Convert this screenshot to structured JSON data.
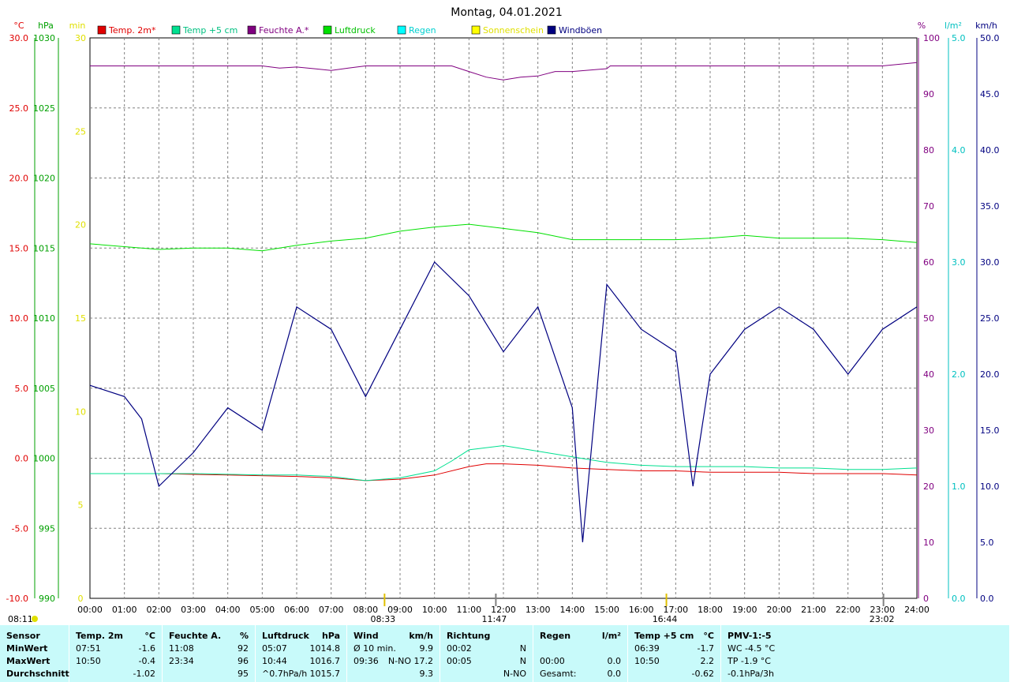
{
  "title": "Montag, 04.01.2021",
  "legend": [
    {
      "label": "Temp. 2m*",
      "color": "#e00000",
      "textColor": "#e00000"
    },
    {
      "label": "Temp +5 cm",
      "color": "#00e090",
      "textColor": "#00c080"
    },
    {
      "label": "Feuchte A.*",
      "color": "#800080",
      "textColor": "#800080"
    },
    {
      "label": "Luftdruck",
      "color": "#00e000",
      "textColor": "#00c000"
    },
    {
      "label": "Regen",
      "color": "#00ffff",
      "textColor": "#00d0d0"
    },
    {
      "label": "Sonnenschein",
      "color": "#ffff00",
      "textColor": "#e0e000"
    },
    {
      "label": "Windböen",
      "color": "#000080",
      "textColor": "#000080"
    }
  ],
  "axes": {
    "temp": {
      "unit": "°C",
      "color": "#e00000",
      "ticks": [
        "30.0",
        "25.0",
        "20.0",
        "15.0",
        "10.0",
        "5.0",
        "0.0",
        "-5.0",
        "-10.0"
      ]
    },
    "pressure": {
      "unit": "hPa",
      "color": "#00a000",
      "ticks": [
        "1030",
        "1025",
        "1020",
        "1015",
        "1010",
        "1005",
        "1000",
        "995",
        "990"
      ]
    },
    "sunshine": {
      "unit": "min",
      "color": "#e0e000",
      "ticks": [
        "30",
        "25",
        "20",
        "15",
        "10",
        "5",
        "0"
      ]
    },
    "humidity": {
      "unit": "%",
      "color": "#800080",
      "ticks": [
        "100",
        "90",
        "80",
        "70",
        "60",
        "50",
        "40",
        "30",
        "20",
        "10",
        "0"
      ]
    },
    "rain": {
      "unit": "l/m²",
      "color": "#00c0c0",
      "ticks": [
        "5.0",
        "4.0",
        "3.0",
        "2.0",
        "1.0",
        "0.0"
      ]
    },
    "wind": {
      "unit": "km/h",
      "color": "#000080",
      "ticks": [
        "50.0",
        "45.0",
        "40.0",
        "35.0",
        "30.0",
        "25.0",
        "20.0",
        "15.0",
        "10.0",
        "5.0",
        "0.0"
      ]
    },
    "x": {
      "ticks": [
        "00:00",
        "01:00",
        "02:00",
        "03:00",
        "04:00",
        "05:00",
        "06:00",
        "07:00",
        "08:00",
        "09:00",
        "10:00",
        "11:00",
        "12:00",
        "13:00",
        "14:00",
        "15:00",
        "16:00",
        "17:00",
        "18:00",
        "19:00",
        "20:00",
        "21:00",
        "22:00",
        "23:00",
        "24:00"
      ]
    }
  },
  "markers": {
    "sunrise_label": "08:11",
    "sunrise_hours": 8.55,
    "marks": [
      {
        "label": "08:33",
        "hour": 8.55,
        "color": "#e0c000"
      },
      {
        "label": "11:47",
        "hour": 11.78,
        "color": "#808080"
      },
      {
        "label": "16:44",
        "hour": 16.73,
        "color": "#e0c000"
      },
      {
        "label": "23:02",
        "hour": 23.03,
        "color": "#808080"
      }
    ]
  },
  "chart_data": {
    "type": "line",
    "x_range_hours": [
      0,
      24
    ],
    "ylim": {
      "temp": [
        -10,
        30
      ],
      "pressure": [
        990,
        1030
      ],
      "humidity": [
        0,
        100
      ],
      "wind": [
        0,
        50
      ],
      "rain": [
        0,
        5
      ],
      "sunshine": [
        0,
        30
      ]
    },
    "grid": true,
    "legend_position": "top",
    "series": [
      {
        "name": "Temp. 2m*",
        "axis": "temp",
        "color": "#e00000",
        "points": [
          [
            0,
            -1.1
          ],
          [
            2,
            -1.1
          ],
          [
            4,
            -1.2
          ],
          [
            6,
            -1.3
          ],
          [
            7,
            -1.4
          ],
          [
            8,
            -1.6
          ],
          [
            9,
            -1.5
          ],
          [
            10,
            -1.2
          ],
          [
            11,
            -0.6
          ],
          [
            11.5,
            -0.4
          ],
          [
            12,
            -0.4
          ],
          [
            13,
            -0.5
          ],
          [
            14,
            -0.7
          ],
          [
            15,
            -0.8
          ],
          [
            16,
            -0.9
          ],
          [
            17,
            -0.9
          ],
          [
            18,
            -1.0
          ],
          [
            19,
            -1.0
          ],
          [
            20,
            -1.0
          ],
          [
            21,
            -1.1
          ],
          [
            22,
            -1.1
          ],
          [
            23,
            -1.1
          ],
          [
            24,
            -1.2
          ]
        ]
      },
      {
        "name": "Temp +5 cm",
        "axis": "temp",
        "color": "#00e090",
        "points": [
          [
            0,
            -1.1
          ],
          [
            3,
            -1.1
          ],
          [
            5,
            -1.2
          ],
          [
            6,
            -1.2
          ],
          [
            7,
            -1.3
          ],
          [
            8,
            -1.6
          ],
          [
            9,
            -1.4
          ],
          [
            10,
            -0.9
          ],
          [
            10.5,
            -0.2
          ],
          [
            11,
            0.6
          ],
          [
            12,
            0.9
          ],
          [
            13,
            0.5
          ],
          [
            14,
            0.1
          ],
          [
            15,
            -0.3
          ],
          [
            16,
            -0.5
          ],
          [
            17,
            -0.6
          ],
          [
            18,
            -0.6
          ],
          [
            19,
            -0.6
          ],
          [
            20,
            -0.7
          ],
          [
            21,
            -0.7
          ],
          [
            22,
            -0.8
          ],
          [
            23,
            -0.8
          ],
          [
            24,
            -0.7
          ]
        ]
      },
      {
        "name": "Feuchte A.*",
        "axis": "humidity",
        "color": "#800080",
        "points": [
          [
            0,
            95
          ],
          [
            5,
            95
          ],
          [
            5.5,
            94.6
          ],
          [
            6,
            94.8
          ],
          [
            6.5,
            94.5
          ],
          [
            7,
            94.2
          ],
          [
            7.5,
            94.6
          ],
          [
            8,
            95
          ],
          [
            10,
            95
          ],
          [
            10.5,
            95
          ],
          [
            11,
            94
          ],
          [
            11.5,
            93
          ],
          [
            12,
            92.5
          ],
          [
            12.5,
            93
          ],
          [
            13,
            93.2
          ],
          [
            13.5,
            94
          ],
          [
            14,
            94
          ],
          [
            15,
            94.5
          ],
          [
            15.1,
            95
          ],
          [
            23,
            95
          ],
          [
            24,
            95.6
          ]
        ]
      },
      {
        "name": "Luftdruck",
        "axis": "pressure",
        "color": "#00e000",
        "points": [
          [
            0,
            1015.3
          ],
          [
            1,
            1015.1
          ],
          [
            2,
            1014.9
          ],
          [
            3,
            1015.0
          ],
          [
            4,
            1015.0
          ],
          [
            5,
            1014.8
          ],
          [
            6,
            1015.2
          ],
          [
            7,
            1015.5
          ],
          [
            8,
            1015.7
          ],
          [
            9,
            1016.2
          ],
          [
            10,
            1016.5
          ],
          [
            11,
            1016.7
          ],
          [
            12,
            1016.4
          ],
          [
            13,
            1016.1
          ],
          [
            14,
            1015.6
          ],
          [
            15,
            1015.6
          ],
          [
            16,
            1015.6
          ],
          [
            17,
            1015.6
          ],
          [
            18,
            1015.7
          ],
          [
            19,
            1015.9
          ],
          [
            20,
            1015.7
          ],
          [
            21,
            1015.7
          ],
          [
            22,
            1015.7
          ],
          [
            23,
            1015.6
          ],
          [
            24,
            1015.4
          ]
        ]
      },
      {
        "name": "Windböen",
        "axis": "wind",
        "color": "#000080",
        "points": [
          [
            0,
            19
          ],
          [
            1,
            18
          ],
          [
            1.5,
            16
          ],
          [
            2,
            10
          ],
          [
            3,
            13
          ],
          [
            4,
            17
          ],
          [
            5,
            15
          ],
          [
            6,
            26
          ],
          [
            7,
            24
          ],
          [
            8,
            18
          ],
          [
            9,
            24
          ],
          [
            10,
            30
          ],
          [
            11,
            27
          ],
          [
            12,
            22
          ],
          [
            13,
            26
          ],
          [
            14,
            17
          ],
          [
            14.3,
            5
          ],
          [
            15,
            28
          ],
          [
            16,
            24
          ],
          [
            17,
            22
          ],
          [
            17.5,
            10
          ],
          [
            18,
            20
          ],
          [
            19,
            24
          ],
          [
            20,
            26
          ],
          [
            21,
            24
          ],
          [
            22,
            20
          ],
          [
            23,
            24
          ],
          [
            24,
            26
          ]
        ]
      }
    ]
  },
  "footer": {
    "sections": [
      {
        "header": [
          "Sensor"
        ],
        "rows": [
          [
            "MinWert"
          ],
          [
            "MaxWert"
          ],
          [
            "Durchschnitt"
          ]
        ]
      },
      {
        "header": [
          "Temp. 2m",
          "°C"
        ],
        "rows": [
          [
            "07:51",
            "-1.6"
          ],
          [
            "10:50",
            "-0.4"
          ],
          [
            "",
            "-1.02"
          ]
        ]
      },
      {
        "header": [
          "Feuchte A.",
          "%"
        ],
        "rows": [
          [
            "11:08",
            "92"
          ],
          [
            "23:34",
            "96"
          ],
          [
            "",
            "95"
          ]
        ]
      },
      {
        "header": [
          "Luftdruck",
          "hPa"
        ],
        "rows": [
          [
            "05:07",
            "1014.8"
          ],
          [
            "10:44",
            "1016.7"
          ],
          [
            "^0.7hPa/h",
            "1015.7"
          ]
        ]
      },
      {
        "header": [
          "Wind",
          "km/h"
        ],
        "rows": [
          [
            "Ø 10 min.",
            "9.9"
          ],
          [
            "09:36",
            "N-NO 17.2"
          ],
          [
            "",
            "9.3"
          ]
        ]
      },
      {
        "header": [
          "Richtung",
          ""
        ],
        "rows": [
          [
            "00:02",
            "N"
          ],
          [
            "00:05",
            "N"
          ],
          [
            "",
            "N-NO"
          ]
        ]
      },
      {
        "header": [
          "Regen",
          "l/m²"
        ],
        "rows": [
          [
            "",
            ""
          ],
          [
            "00:00",
            "0.0"
          ],
          [
            "Gesamt:",
            "0.0"
          ]
        ]
      },
      {
        "header": [
          "Temp +5 cm",
          "°C"
        ],
        "rows": [
          [
            "06:39",
            "-1.7"
          ],
          [
            "10:50",
            "2.2"
          ],
          [
            "",
            "-0.62"
          ]
        ]
      },
      {
        "header": [
          "PMV-1:-5",
          ""
        ],
        "rows": [
          [
            "WC -4.5 °C",
            ""
          ],
          [
            "TP -1.9 °C",
            ""
          ],
          [
            "-0.1hPa/3h",
            ""
          ]
        ]
      }
    ]
  }
}
